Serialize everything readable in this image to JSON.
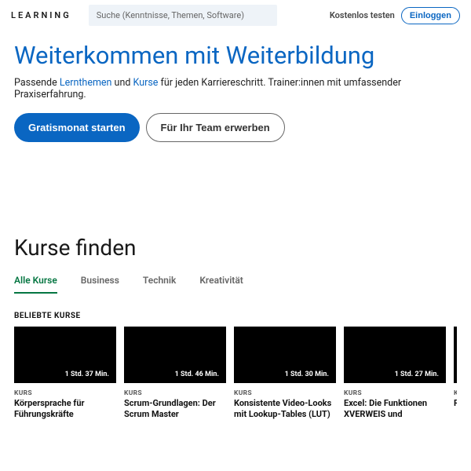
{
  "header": {
    "logo": "LEARNING",
    "search_placeholder": "Suche (Kenntnisse, Themen, Software)",
    "trial": "Kostenlos testen",
    "login": "Einloggen"
  },
  "hero": {
    "title": "Weiterkommen mit Weiterbildung",
    "sub_prefix": "Passende ",
    "sub_link1": "Lernthemen",
    "sub_mid": " und ",
    "sub_link2": "Kurse",
    "sub_suffix": " für jeden Karriereschritt. Trainer:innen mit umfassender Praxiserfahrung.",
    "cta_primary": "Gratismonat starten",
    "cta_outline": "Für Ihr Team erwerben"
  },
  "section": {
    "heading": "Kurse finden",
    "tabs": [
      "Alle Kurse",
      "Business",
      "Technik",
      "Kreativität"
    ],
    "subhead": "BELIEBTE KURSE",
    "type_label": "KURS"
  },
  "cards": [
    {
      "duration": "1 Std. 37 Min.",
      "title": "Körpersprache für Führungskräfte"
    },
    {
      "duration": "1 Std. 46 Min.",
      "title": "Scrum-Grundlagen: Der Scrum Master"
    },
    {
      "duration": "1 Std. 30 Min.",
      "title": "Konsistente Video-Looks mit Lookup-Tables (LUT)"
    },
    {
      "duration": "1 Std. 27 Min.",
      "title": "Excel: Die Funktionen XVERWEIS und"
    },
    {
      "duration": "",
      "title": "R"
    }
  ]
}
